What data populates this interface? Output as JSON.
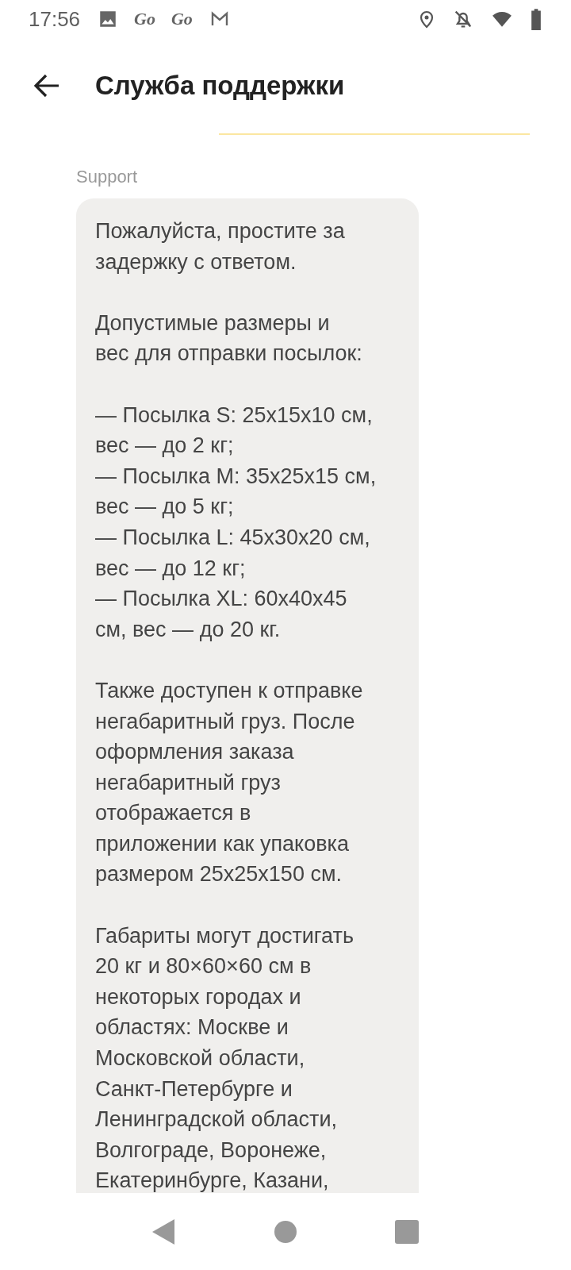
{
  "status_bar": {
    "time": "17:56",
    "app_badges": [
      "Go",
      "Go"
    ]
  },
  "header": {
    "title": "Служба поддержки"
  },
  "messages": [
    {
      "sender": "Support",
      "paragraphs": [
        {
          "lines": [
            "Пожалуйста, простите за",
            "задержку с ответом."
          ]
        },
        {
          "lines": [
            "Допустимые размеры и",
            "вес для отправки посылок:"
          ]
        },
        {
          "lines": [
            "— Посылка S: 25x15x10 см,",
            "вес — до 2 кг;",
            "— Посылка M: 35x25x15 см,",
            "вес — до 5 кг;",
            "— Посылка L: 45x30x20 см,",
            "вес — до 12 кг;",
            "— Посылка XL: 60x40x45",
            "см, вес — до 20 кг."
          ]
        },
        {
          "lines": [
            "Также доступен к отправке",
            "негабаритный груз. После",
            "оформления заказа",
            "негабаритный груз",
            "отображается в",
            "приложении как упаковка",
            "размером 25x25x150 см."
          ]
        },
        {
          "lines": [
            "Габариты могут достигать",
            "20 кг и 80×60×60 см в",
            "некоторых городах и",
            "областях: Москве и",
            "Московской области,",
            "Санкт-Петербурге и",
            "Ленинградской области,",
            "Волгограде, Воронеже,",
            "Екатеринбурге, Казани,"
          ]
        }
      ]
    }
  ]
}
